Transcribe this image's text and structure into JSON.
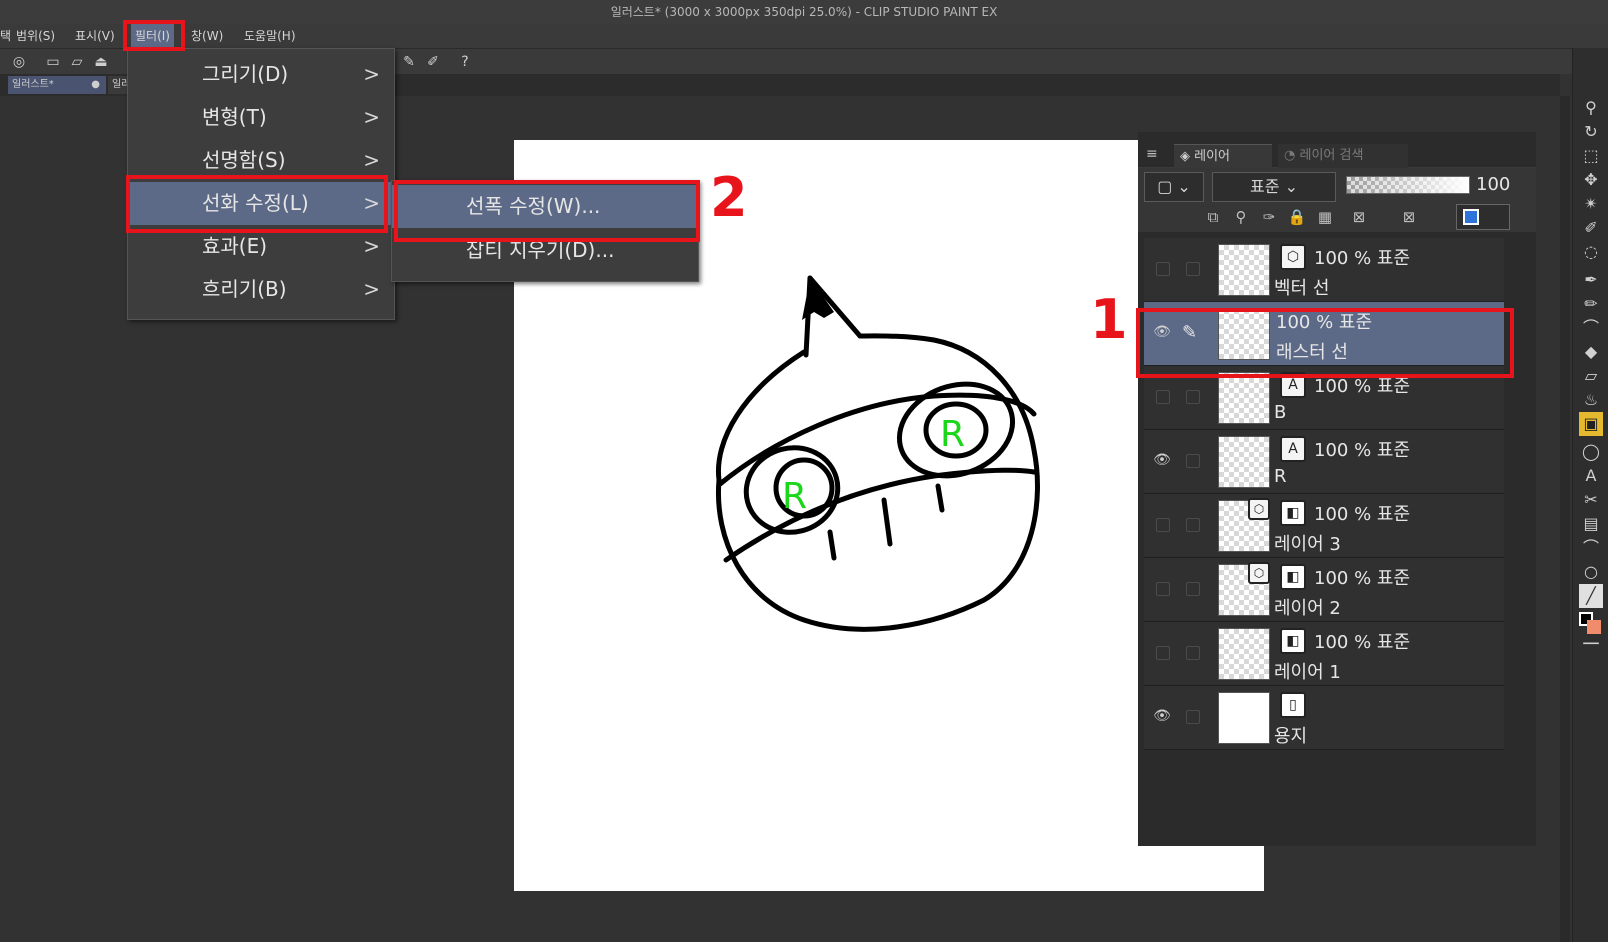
{
  "window": {
    "title": "일러스트* (3000 x 3000px 350dpi 25.0%)  - CLIP STUDIO PAINT EX"
  },
  "menubar": {
    "items": [
      "택",
      "범위(S)",
      "표시(V)",
      "필터(I)",
      "창(W)",
      "도움말(H)"
    ]
  },
  "tabs": {
    "doc1": "일러스트*",
    "doc2": "일러"
  },
  "filter_menu": {
    "items": [
      {
        "label": "그리기(D)"
      },
      {
        "label": "변형(T)"
      },
      {
        "label": "선명함(S)"
      },
      {
        "label": "선화 수정(L)"
      },
      {
        "label": "효과(E)"
      },
      {
        "label": "흐리기(B)"
      }
    ],
    "submenu": [
      {
        "label": "선폭 수정(W)..."
      },
      {
        "label": "잡티 지우기(D)..."
      }
    ]
  },
  "layer_panel": {
    "tab_layer": "레이어",
    "tab_search": "레이어 검색",
    "blend_mode": "표준",
    "opacity": "100",
    "layers": [
      {
        "mode": "100 % 표준",
        "name": "벡터 선",
        "visible": false,
        "type": "vector"
      },
      {
        "mode": "100 % 표준",
        "name": "래스터 선",
        "visible": true,
        "selected": true,
        "type": "raster"
      },
      {
        "mode": "100 % 표준",
        "name": "B",
        "visible": false,
        "type": "text"
      },
      {
        "mode": "100 % 표준",
        "name": "R",
        "visible": true,
        "type": "text"
      },
      {
        "mode": "100 % 표준",
        "name": "레이어 3",
        "visible": false,
        "type": "color"
      },
      {
        "mode": "100 % 표준",
        "name": "레이어 2",
        "visible": false,
        "type": "color"
      },
      {
        "mode": "100 % 표준",
        "name": "레이어 1",
        "visible": false,
        "type": "color"
      },
      {
        "mode": "",
        "name": "용지",
        "visible": true,
        "type": "paper"
      }
    ]
  },
  "canvas": {
    "drawing_text_left": "R",
    "drawing_text_right": "R"
  },
  "annotations": {
    "marker1": "1",
    "marker2": "2"
  },
  "colors": {
    "accent": "#5d6a87",
    "annotation_red": "#e8141b",
    "eye_green": "#1bd61b"
  }
}
